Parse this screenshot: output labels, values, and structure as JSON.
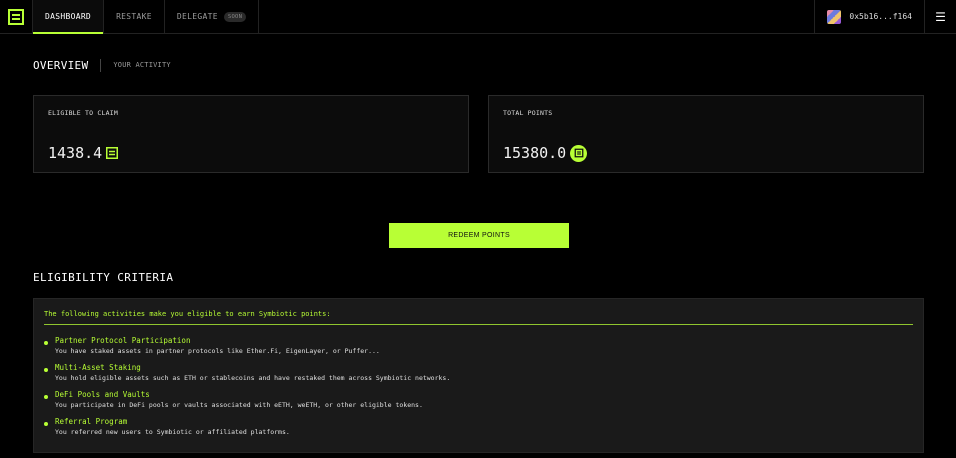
{
  "nav": {
    "tabs": [
      {
        "label": "DASHBOARD",
        "active": true
      },
      {
        "label": "RESTAKE"
      },
      {
        "label": "DELEGATE",
        "badge": "SOON"
      }
    ],
    "wallet": "0x5b16...f164",
    "menu_icon": "hamburger-icon"
  },
  "overview": {
    "title": "OVERVIEW",
    "subtitle": "YOUR ACTIVITY"
  },
  "cards": {
    "eligible": {
      "label": "ELIGIBLE TO CLAIM",
      "value": "1438.4",
      "icon": "symbiotic-logo-icon"
    },
    "total": {
      "label": "TOTAL POINTS",
      "value": "15380.0",
      "icon": "points-coin-icon"
    }
  },
  "redeem": {
    "label": "REDEEM POINTS"
  },
  "criteria": {
    "title": "ELIGIBILITY CRITERIA",
    "intro": "The following activities make you eligible to earn Symbiotic points:",
    "items": [
      {
        "name": "Partner Protocol Participation",
        "desc": "You have staked assets in partner protocols like Ether.Fi, EigenLayer, or Puffer..."
      },
      {
        "name": "Multi-Asset Staking",
        "desc": "You hold eligible assets such as ETH or stablecoins and have restaked them across Symbiotic networks."
      },
      {
        "name": "DeFi Pools and Vaults",
        "desc": "You participate in DeFi pools or vaults associated with eETH, weETH, or other eligible tokens."
      },
      {
        "name": "Referral Program",
        "desc": "You referred new users to Symbiotic or affiliated platforms."
      }
    ]
  },
  "colors": {
    "accent": "#b8ff35",
    "background": "#000000",
    "card": "#0c0c0c",
    "panel": "#1a1a1a"
  }
}
